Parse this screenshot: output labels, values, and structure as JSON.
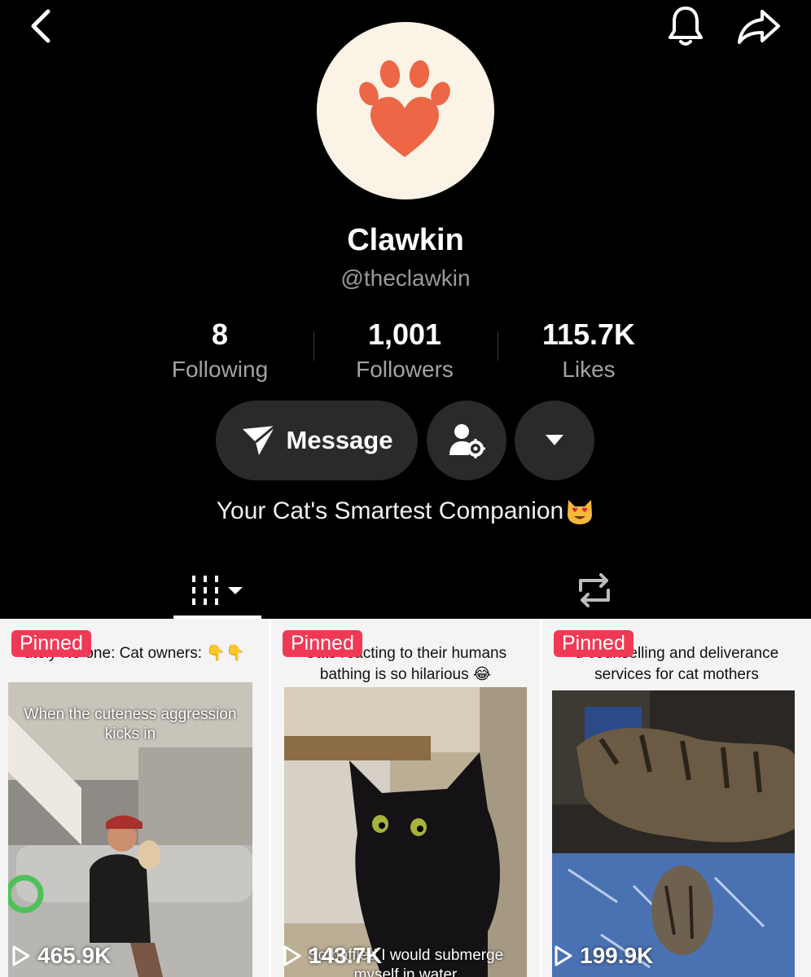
{
  "profile": {
    "name": "Clawkin",
    "handle": "@theclawkin",
    "bio": "Your Cat's Smartest Companion",
    "avatar_icon": "paw-heart-icon",
    "accent_color": "#ed6645"
  },
  "stats": {
    "following": {
      "value": "8",
      "label": "Following"
    },
    "followers": {
      "value": "1,001",
      "label": "Followers"
    },
    "likes": {
      "value": "115.7K",
      "label": "Likes"
    }
  },
  "actions": {
    "message_label": "Message"
  },
  "videos": [
    {
      "badge": "Pinned",
      "caption": "utely No one: Cat owners: 👇👇",
      "overlay": "When the cuteness aggression kicks in",
      "views": "465.9K"
    },
    {
      "badge": "Pinned",
      "caption": "Cats reacting to their humans bathing is so hilarious 😂",
      "overlay": "So baffled I would submerge myself in water",
      "views": "143.7K"
    },
    {
      "badge": "Pinned",
      "caption": "d counselling and deliverance services for cat mothers",
      "overlay": "",
      "views": "199.9K"
    }
  ]
}
